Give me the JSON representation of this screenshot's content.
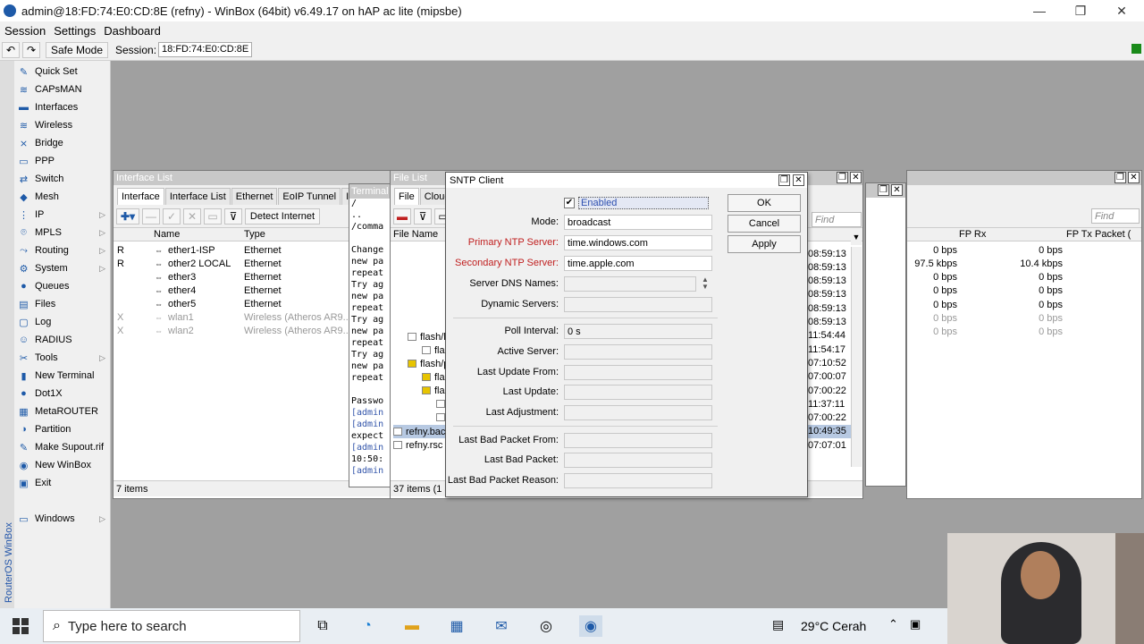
{
  "window": {
    "title": "admin@18:FD:74:E0:CD:8E (refny) - WinBox (64bit) v6.49.17 on hAP ac lite (mipsbe)",
    "minimize": "—",
    "maximize": "❐",
    "close": "✕"
  },
  "menu": [
    "Session",
    "Settings",
    "Dashboard"
  ],
  "toolbar": {
    "undo": "↶",
    "redo": "↷",
    "safe_mode": "Safe Mode",
    "session_label": "Session:",
    "session_value": "18:FD:74:E0:CD:8E"
  },
  "sidebar": {
    "vertical_label": "RouterOS WinBox",
    "items": [
      {
        "label": "Quick Set",
        "icon": "wand-icon",
        "glyph": "✎"
      },
      {
        "label": "CAPsMAN",
        "icon": "antenna-icon",
        "glyph": "≋"
      },
      {
        "label": "Interfaces",
        "icon": "interfaces-icon",
        "glyph": "▬"
      },
      {
        "label": "Wireless",
        "icon": "wireless-icon",
        "glyph": "≋"
      },
      {
        "label": "Bridge",
        "icon": "bridge-icon",
        "glyph": "⨯"
      },
      {
        "label": "PPP",
        "icon": "ppp-icon",
        "glyph": "▭"
      },
      {
        "label": "Switch",
        "icon": "switch-icon",
        "glyph": "⇄"
      },
      {
        "label": "Mesh",
        "icon": "mesh-icon",
        "glyph": "◆"
      },
      {
        "label": "IP",
        "icon": "ip-icon",
        "glyph": "⋮",
        "arrow": "▷"
      },
      {
        "label": "MPLS",
        "icon": "mpls-icon",
        "glyph": "⌾",
        "arrow": "▷"
      },
      {
        "label": "Routing",
        "icon": "routing-icon",
        "glyph": "⤳",
        "arrow": "▷"
      },
      {
        "label": "System",
        "icon": "system-icon",
        "glyph": "⚙",
        "arrow": "▷"
      },
      {
        "label": "Queues",
        "icon": "queues-icon",
        "glyph": "●"
      },
      {
        "label": "Files",
        "icon": "files-icon",
        "glyph": "▤"
      },
      {
        "label": "Log",
        "icon": "log-icon",
        "glyph": "▢"
      },
      {
        "label": "RADIUS",
        "icon": "radius-icon",
        "glyph": "☺"
      },
      {
        "label": "Tools",
        "icon": "tools-icon",
        "glyph": "✂",
        "arrow": "▷"
      },
      {
        "label": "New Terminal",
        "icon": "terminal-icon",
        "glyph": "▮"
      },
      {
        "label": "Dot1X",
        "icon": "dot1x-icon",
        "glyph": "●"
      },
      {
        "label": "MetaROUTER",
        "icon": "metarouter-icon",
        "glyph": "▦"
      },
      {
        "label": "Partition",
        "icon": "partition-icon",
        "glyph": "◑"
      },
      {
        "label": "Make Supout.rif",
        "icon": "supout-icon",
        "glyph": "✎"
      },
      {
        "label": "New WinBox",
        "icon": "winbox-icon",
        "glyph": "◉"
      },
      {
        "label": "Exit",
        "icon": "exit-icon",
        "glyph": "▣"
      },
      {
        "label": "Windows",
        "icon": "windows-icon",
        "glyph": "▭",
        "arrow": "▷"
      }
    ]
  },
  "interface_list": {
    "title": "Interface List",
    "tabs": [
      "Interface",
      "Interface List",
      "Ethernet",
      "EoIP Tunnel",
      "IP"
    ],
    "detect_internet": "Detect Internet",
    "col_name": "Name",
    "col_type": "Type",
    "rows": [
      {
        "flag": "R",
        "name": "ether1-ISP",
        "type": "Ethernet",
        "disabled": false
      },
      {
        "flag": "R",
        "name": "other2 LOCAL",
        "type": "Ethernet",
        "disabled": false
      },
      {
        "flag": "",
        "name": "ether3",
        "type": "Ethernet",
        "disabled": false
      },
      {
        "flag": "",
        "name": "ether4",
        "type": "Ethernet",
        "disabled": false
      },
      {
        "flag": "",
        "name": "other5",
        "type": "Ethernet",
        "disabled": false
      },
      {
        "flag": "X",
        "name": "wlan1",
        "type": "Wireless (Atheros AR9...",
        "disabled": true
      },
      {
        "flag": "X",
        "name": "wlan2",
        "type": "Wireless (Atheros AR9...",
        "disabled": true
      }
    ],
    "status": "7 items"
  },
  "terminal": {
    "title": "Terminal",
    "lines": [
      "/",
      "..",
      "/comma",
      "",
      "Change",
      "new pa",
      "repeat",
      "Try ag",
      "new pa",
      "repeat",
      "Try ag",
      "new pa",
      "repeat",
      "Try ag",
      "new pa",
      "repeat",
      "",
      "Passwo",
      "[admin",
      "[admin",
      "expect",
      "[admin",
      "10:50:",
      "[admin"
    ]
  },
  "file_list": {
    "title": "File List",
    "tabs": [
      "File",
      "Cloud"
    ],
    "col_name": "File Name",
    "rows": [
      "flash/l",
      "flash/l",
      "flash/p",
      "flash/s",
      "flash/r",
      "fla",
      "fla",
      "refny.bac",
      "refny.rsc"
    ],
    "status": "37 items (1 s"
  },
  "file_times": [
    "08:59:13",
    "08:59:13",
    "08:59:13",
    "08:59:13",
    "08:59:13",
    "08:59:13",
    "11:54:44",
    "11:54:17",
    "07:10:52",
    "07:00:07",
    "07:00:22",
    "11:37:11",
    "07:00:22",
    "10:49:35",
    "07:07:01"
  ],
  "find_placeholder": "Find",
  "traffic": {
    "col_fp_rx": "FP Rx",
    "col_fp_tx": "FP Tx Packet (",
    "rows": [
      {
        "rx": "0 bps",
        "tx": "0 bps"
      },
      {
        "rx": "97.5 kbps",
        "tx": "10.4 kbps"
      },
      {
        "rx": "0 bps",
        "tx": "0 bps"
      },
      {
        "rx": "0 bps",
        "tx": "0 bps"
      },
      {
        "rx": "0 bps",
        "tx": "0 bps"
      },
      {
        "rx": "0 bps",
        "tx": "0 bps"
      },
      {
        "rx": "0 bps",
        "tx": "0 bps"
      }
    ]
  },
  "sntp": {
    "title": "SNTP Client",
    "enabled_label": "Enabled",
    "enabled": true,
    "mode_label": "Mode:",
    "mode_value": "broadcast",
    "primary_label": "Primary NTP Server:",
    "primary_value": "time.windows.com",
    "secondary_label": "Secondary NTP Server:",
    "secondary_value": "time.apple.com",
    "dns_names_label": "Server DNS Names:",
    "dynamic_servers_label": "Dynamic Servers:",
    "poll_interval_label": "Poll Interval:",
    "poll_interval_value": "0 s",
    "active_server_label": "Active Server:",
    "last_update_from_label": "Last Update From:",
    "last_update_label": "Last Update:",
    "last_adjustment_label": "Last Adjustment:",
    "last_bad_from_label": "Last Bad Packet From:",
    "last_bad_label": "Last Bad Packet:",
    "last_bad_reason_label": "Last Bad Packet Reason:",
    "ok": "OK",
    "cancel": "Cancel",
    "apply": "Apply"
  },
  "taskbar": {
    "search_placeholder": "Type here to search",
    "weather": "29°C  Cerah"
  },
  "colors": {
    "accent_blue": "#1e5aa8",
    "required_red": "#c02020",
    "workspace_gray": "#a0a0a0"
  }
}
